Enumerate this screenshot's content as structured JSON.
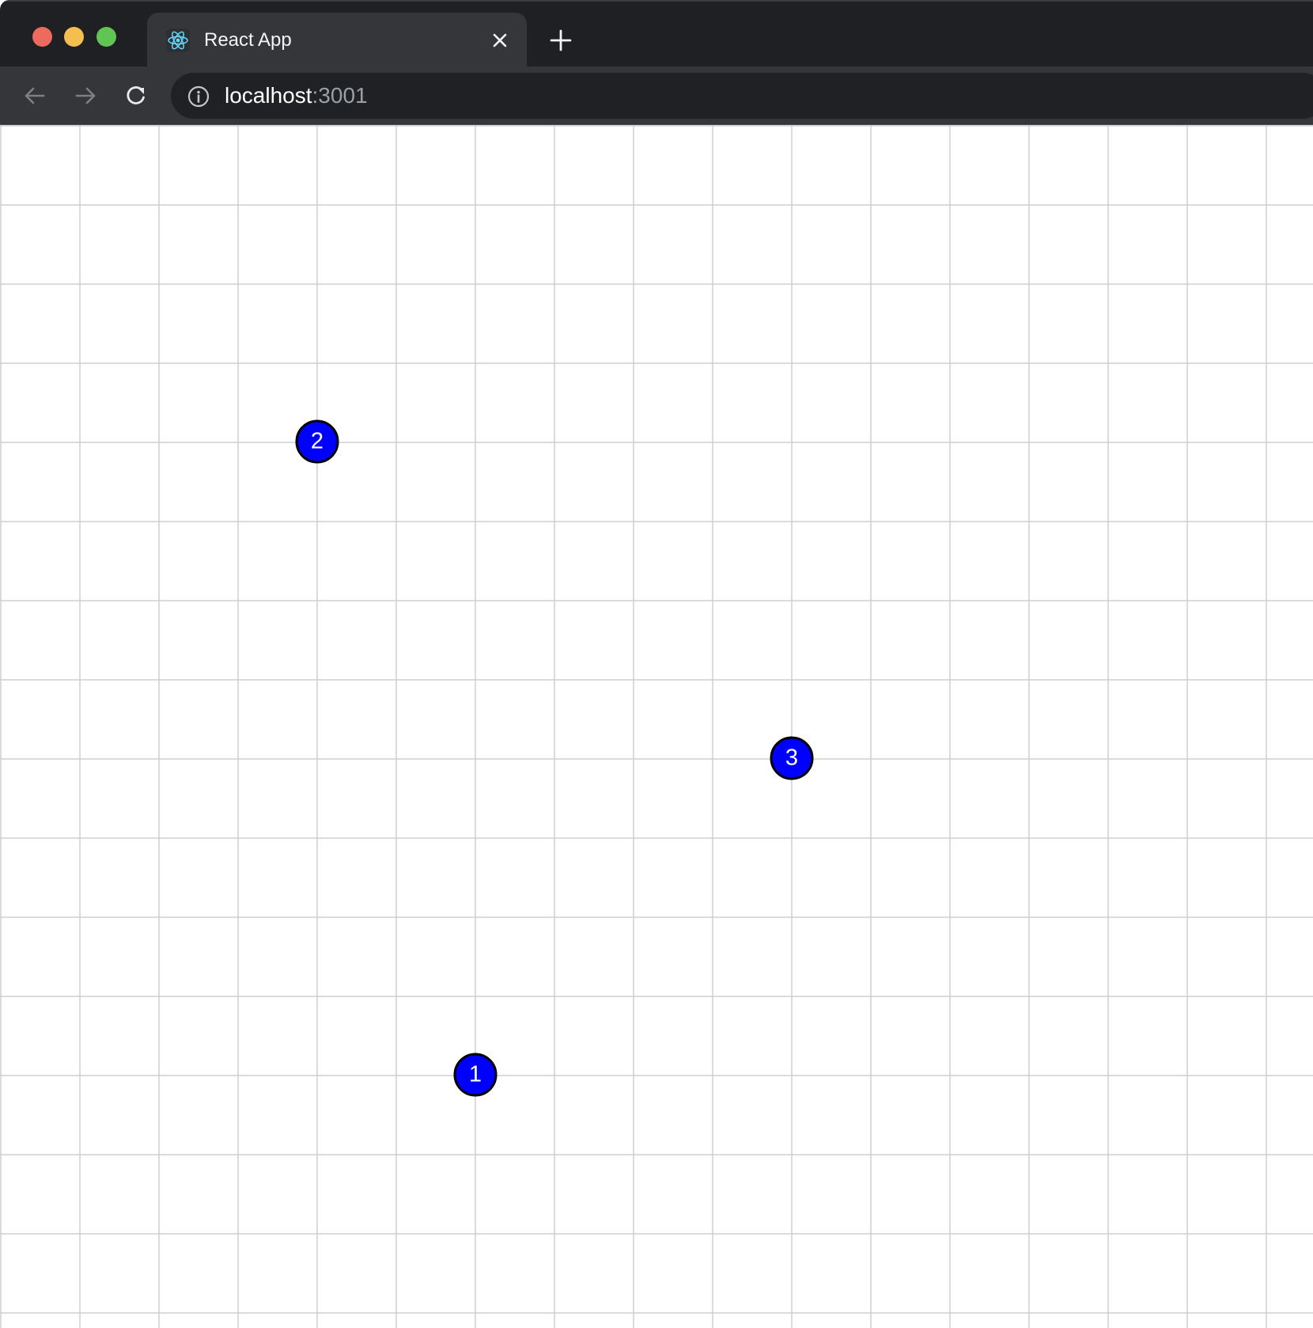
{
  "window": {
    "traffic_lights": {
      "close_color": "#ed6a5e",
      "minimize_color": "#f5bf4f",
      "maximize_color": "#61c554"
    }
  },
  "tab": {
    "title": "React App",
    "favicon": "react-logo-icon",
    "close_icon": "close-icon"
  },
  "new_tab": {
    "icon": "plus-icon"
  },
  "toolbar": {
    "back_icon": "arrow-left-icon",
    "forward_icon": "arrow-right-icon",
    "reload_icon": "reload-icon",
    "site_info_icon": "info-icon",
    "url_host": "localhost",
    "url_port": ":3001"
  },
  "canvas": {
    "background": "#ffffff",
    "grid_line_color": "#cfcfcf",
    "marker_fill": "#0000ff",
    "marker_stroke": "#000000",
    "marker_text_color": "#ffffff",
    "markers": [
      {
        "label": "1"
      },
      {
        "label": "2"
      },
      {
        "label": "3"
      }
    ]
  }
}
